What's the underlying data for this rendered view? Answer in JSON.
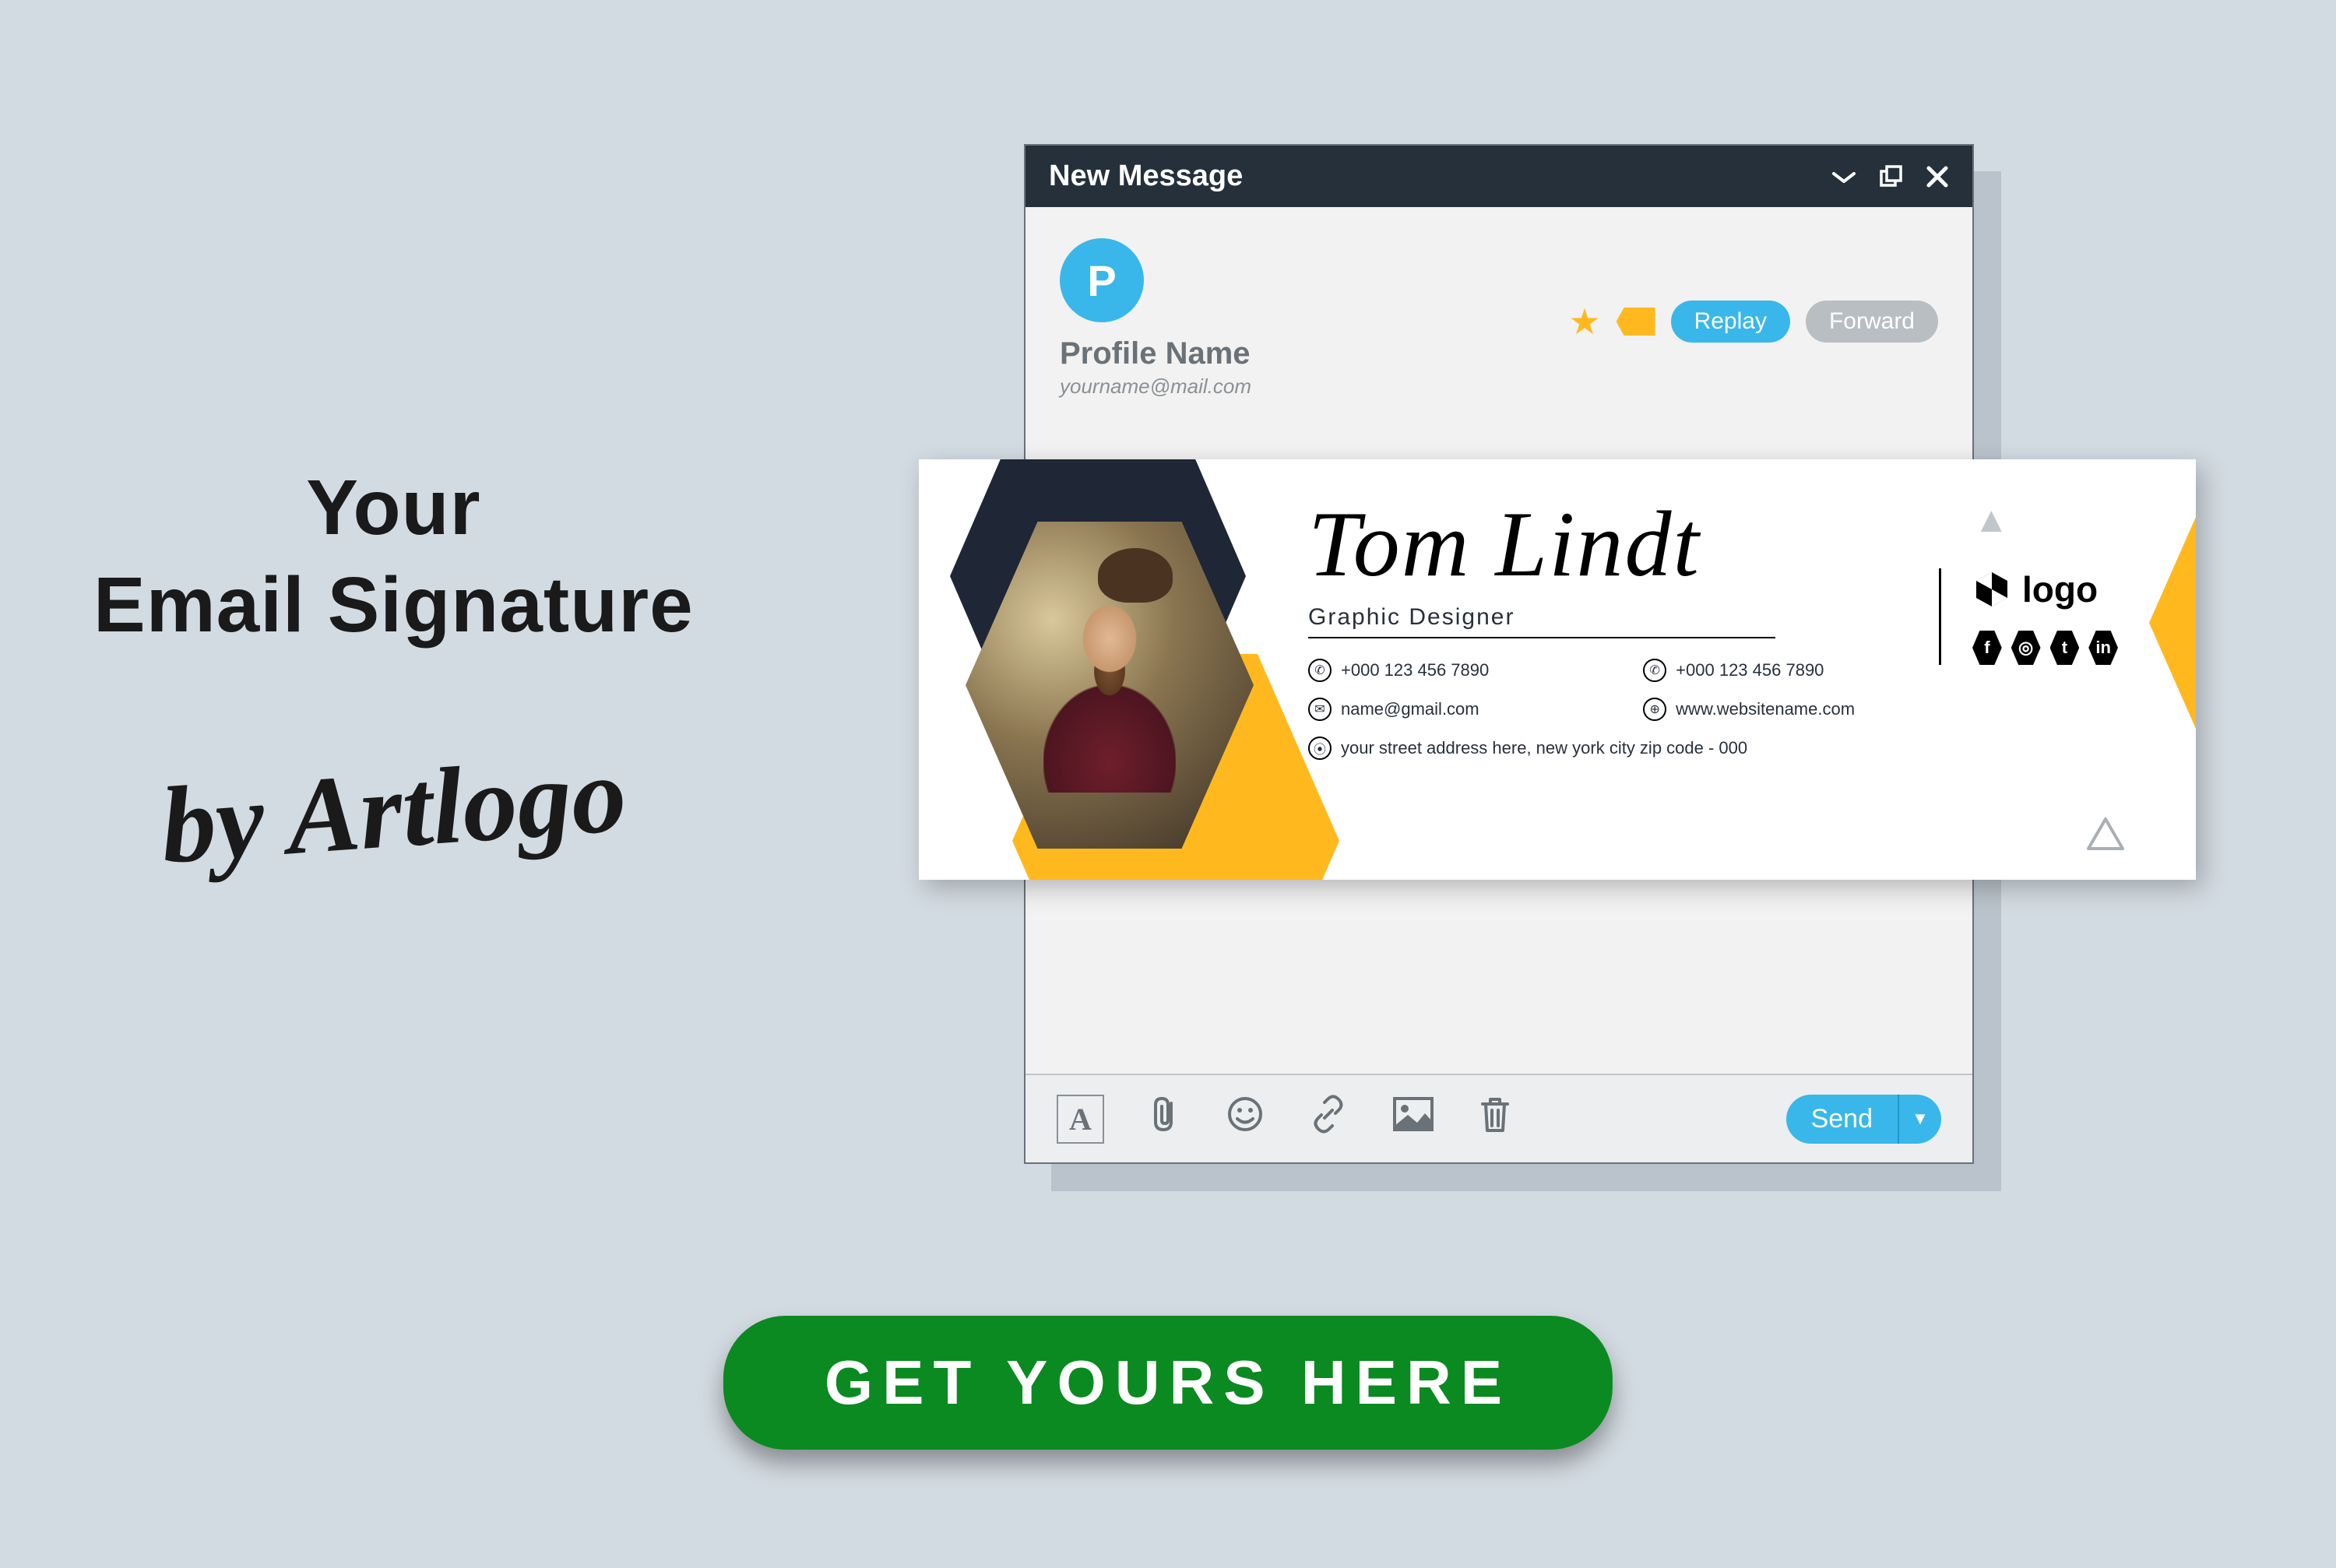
{
  "headline": {
    "line1": "Your",
    "line2": "Email Signature"
  },
  "byline": "by Artlogo",
  "compose": {
    "title": "New Message",
    "avatar_letter": "P",
    "profile_name": "Profile Name",
    "profile_email": "yourname@mail.com",
    "replay_label": "Replay",
    "forward_label": "Forward",
    "send_label": "Send",
    "toolbar": {
      "format": "A"
    }
  },
  "signature": {
    "name": "Tom Lindt",
    "title": "Graphic Designer",
    "phone1": "+000 123 456 7890",
    "phone2": "+000 123 456 7890",
    "email": "name@gmail.com",
    "website": "www.websitename.com",
    "address": "your street address here, new york city zip code - 000",
    "logo_text": "logo",
    "logo_mark": "L",
    "socials": [
      "f",
      "◎",
      "t",
      "in"
    ]
  },
  "cta": "GET YOURS HERE"
}
